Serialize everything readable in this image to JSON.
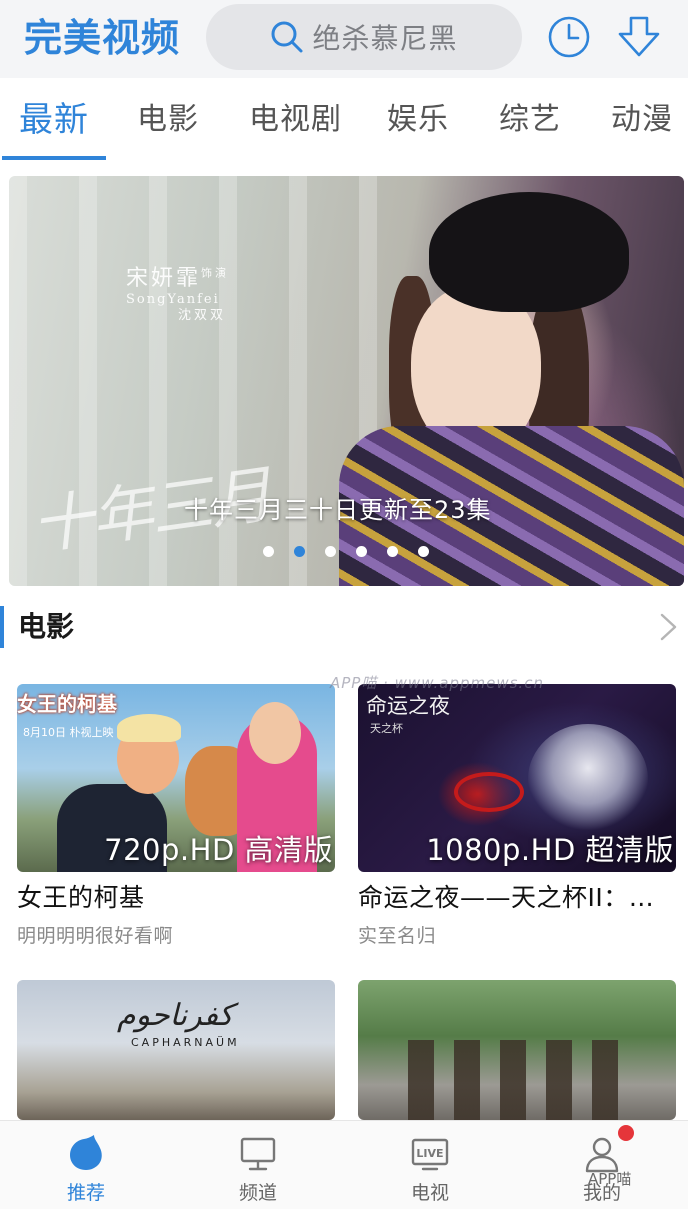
{
  "header": {
    "logo": "完美视频",
    "search_placeholder": "绝杀慕尼黑",
    "history_icon": "clock-icon",
    "download_icon": "download-icon",
    "accent_color": "#2f84d9"
  },
  "tabs": [
    {
      "label": "最新",
      "active": true
    },
    {
      "label": "电影",
      "active": false
    },
    {
      "label": "电视剧",
      "active": false
    },
    {
      "label": "娱乐",
      "active": false
    },
    {
      "label": "综艺",
      "active": false
    },
    {
      "label": "动漫",
      "active": false
    }
  ],
  "banner": {
    "credit_name": "宋妍霏",
    "credit_role_small": "饰演",
    "credit_english": "SongYanfei",
    "credit_character": "沈双双",
    "calligraphy": "十年三月",
    "caption": "十年三月三十日更新至23集",
    "slide_count": 6,
    "active_slide": 2
  },
  "section": {
    "title": "电影",
    "more_icon": "chevron-right-icon"
  },
  "cards": [
    {
      "title": "女王的柯基",
      "subtitle": "明明明明很好看啊",
      "quality": "720p.HD 高清版",
      "poster_logo": "女王的柯基",
      "poster_date": "8月10日 朴视上映"
    },
    {
      "title": "命运之夜——天之杯II：…",
      "subtitle": "实至名归",
      "quality": "1080p.HD 超清版",
      "poster_logo": "命运之夜",
      "poster_sub": "天之杯"
    },
    {
      "title": "",
      "subtitle": "",
      "poster_logo": "كفرناحوم",
      "poster_sub": "CAPHARNAÜM"
    },
    {
      "title": "",
      "subtitle": ""
    }
  ],
  "watermark": "APP喵 · www.appmews.cn",
  "bottom_nav": [
    {
      "label": "推荐",
      "icon": "recommend-icon",
      "active": true
    },
    {
      "label": "频道",
      "icon": "monitor-icon",
      "active": false
    },
    {
      "label": "电视",
      "icon": "live-tv-icon",
      "active": false,
      "icon_text": "LIVE"
    },
    {
      "label": "我的",
      "icon": "profile-icon",
      "active": false,
      "badge": true
    }
  ],
  "app_watermark": "APP喵"
}
